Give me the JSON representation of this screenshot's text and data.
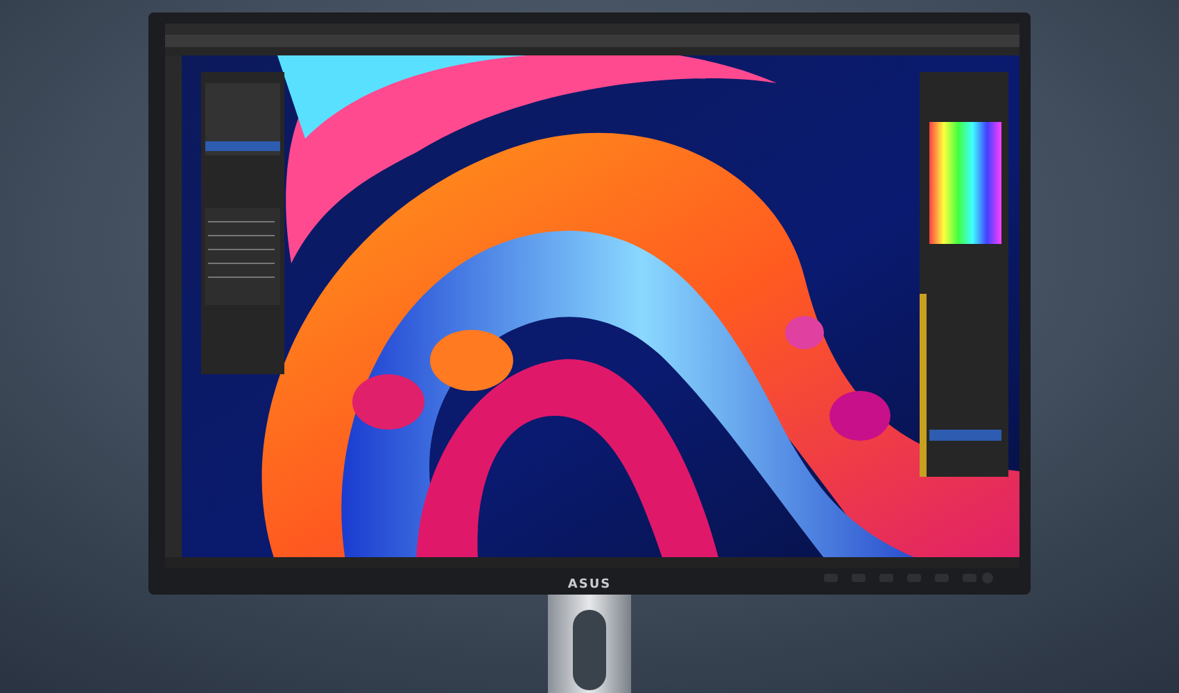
{
  "monitor": {
    "logo": "ASUS"
  }
}
